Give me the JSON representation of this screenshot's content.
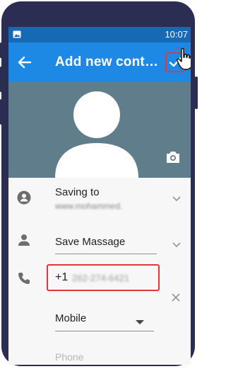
{
  "status_bar": {
    "time": "10:07",
    "icon": "image-icon"
  },
  "toolbar": {
    "title": "Add new cont…",
    "back_icon": "arrow-left-icon",
    "save_icon": "check-icon"
  },
  "photo": {
    "avatar_icon": "person-silhouette-icon",
    "camera_icon": "camera-icon"
  },
  "form": {
    "saving_to_label": "Saving to",
    "saving_to_account": "www.mohammed.",
    "name_value": "Save Massage",
    "phone_prefix": "+1",
    "phone_number": "262-274-6421",
    "phone_type": "Mobile",
    "phone_placeholder": "Phone"
  },
  "colors": {
    "toolbar": "#1e88e5",
    "status_bar": "#1669b3",
    "photo_bg": "#5f7d8a",
    "highlight": "#e8343a",
    "phone_frame": "#2b2d52"
  }
}
